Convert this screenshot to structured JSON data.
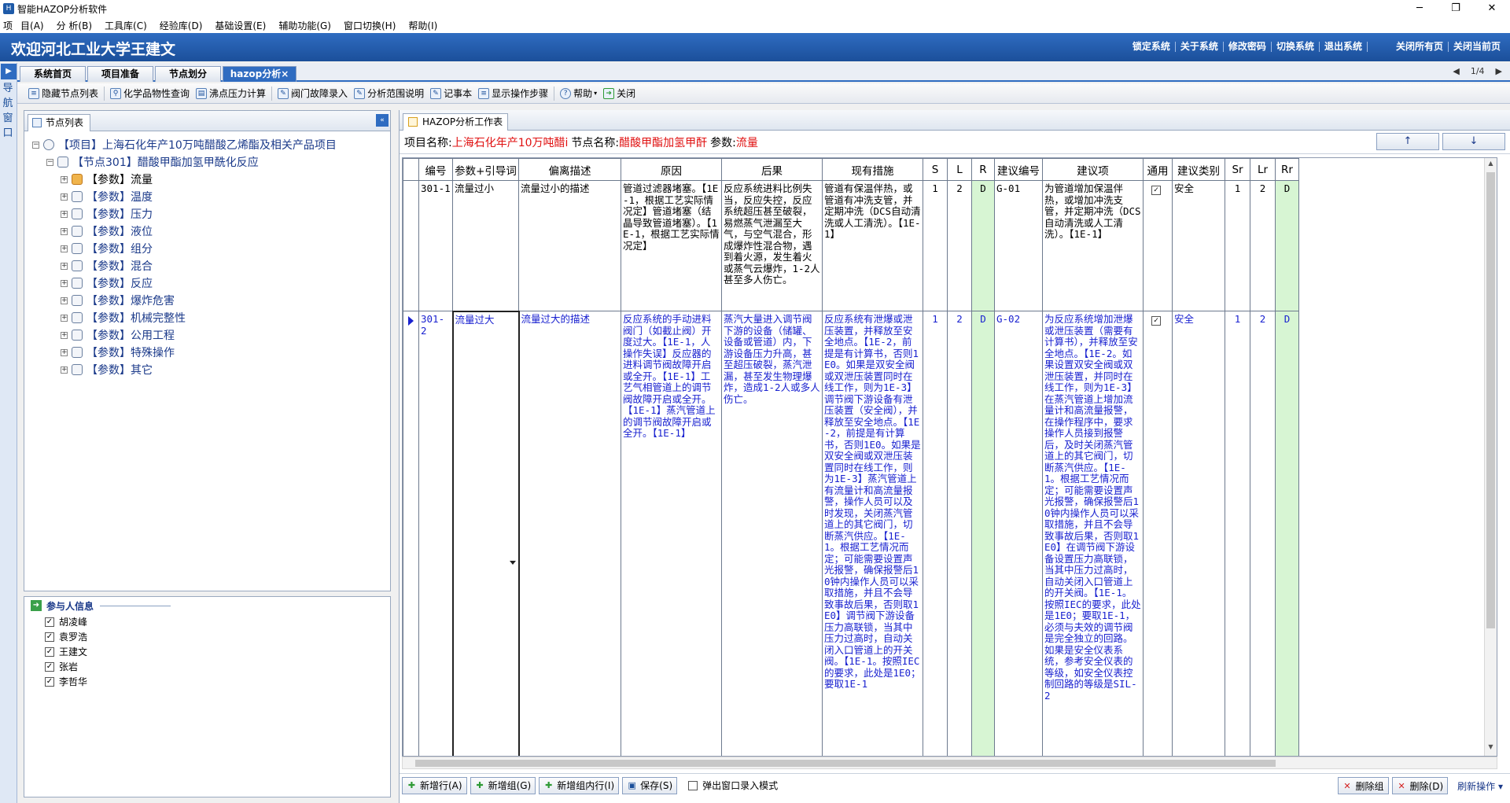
{
  "window": {
    "title": "智能HAZOP分析软件",
    "min": "─",
    "max": "❐",
    "close": "✕"
  },
  "menu": [
    "项",
    "目(A)",
    "分 析(B)",
    "工具库(C)",
    "经验库(D)",
    "基础设置(E)",
    "辅助功能(G)",
    "窗口切换(H)",
    "帮助(I)"
  ],
  "banner": {
    "welcome": "欢迎河北工业大学王建文",
    "links": [
      "锁定系统",
      "关于系统",
      "修改密码",
      "切换系统",
      "退出系统"
    ],
    "links2": [
      "关闭所有页",
      "关闭当前页"
    ]
  },
  "nav": {
    "arrow": "▶",
    "label": [
      "导",
      "航",
      "窗",
      "口"
    ]
  },
  "tabs": [
    "系统首页",
    "项目准备",
    "节点划分",
    "hazop分析×"
  ],
  "pager": {
    "prev": "◀",
    "page": "1/4",
    "next": "▶"
  },
  "toolbar": [
    "隐藏节点列表",
    "化学品物性查询",
    "沸点压力计算",
    "阀门故障录入",
    "分析范围说明",
    "记事本",
    "显示操作步骤",
    "帮助",
    "关闭"
  ],
  "left": {
    "tab": "节点列表",
    "collapse": "«",
    "project": "【项目】上海石化年产10万吨醋酸乙烯酯及相关产品项目",
    "node": "【节点301】醋酸甲酯加氢甲酰化反应",
    "params": [
      "【参数】流量",
      "【参数】温度",
      "【参数】压力",
      "【参数】液位",
      "【参数】组分",
      "【参数】混合",
      "【参数】反应",
      "【参数】爆炸危害",
      "【参数】机械完整性",
      "【参数】公用工程",
      "【参数】特殊操作",
      "【参数】其它"
    ]
  },
  "participants": {
    "title": "参与人信息",
    "people": [
      "胡凌峰",
      "袁罗浩",
      "王建文",
      "张岩",
      "李哲华"
    ]
  },
  "right": {
    "tab": "HAZOP分析工作表",
    "info": {
      "projLabel": "项目名称:",
      "projValue": "上海石化年产10万吨醋i",
      "nodeLabel": "节点名称:",
      "nodeValue": "醋酸甲酯加氢甲酐",
      "paramLabel": "参数:",
      "paramValue": "流量"
    },
    "up": "↑",
    "down": "↓"
  },
  "grid": {
    "headers": [
      "编号",
      "参数+引导词",
      "偏离描述",
      "原因",
      "后果",
      "现有措施",
      "S",
      "L",
      "R",
      "建议编号",
      "建议项",
      "通用",
      "建议类别",
      "Sr",
      "Lr",
      "Rr"
    ],
    "rows": [
      {
        "id": "301-1",
        "param": "流量过小",
        "dev": "流量过小的描述",
        "cause": "管道过滤器堵塞。【1E-1，根据工艺实际情况定】管道堵塞（结晶导致管道堵塞）。【1E-1，根据工艺实际情况定】",
        "conseq": "反应系统进料比例失当，反应失控，反应系统超压甚至破裂，易燃蒸气泄漏至大气，与空气混合，形成爆炸性混合物，遇到着火源，发生着火或蒸气云爆炸，1-2人甚至多人伤亡。",
        "measure": "管道有保温伴热，或管道有冲洗支管，并定期冲洗（DCS自动清洗或人工清洗）。【1E-1】",
        "s": "1",
        "l": "2",
        "r": "D",
        "sid": "G-01",
        "sugg": "为管道增加保温伴热，或增加冲洗支管，并定期冲洗（DCS自动清洗或人工清洗）。【1E-1】",
        "common": "✓",
        "cat": "安全",
        "sr": "1",
        "lr": "2",
        "rr": "D"
      },
      {
        "id": "301-2",
        "param": "流量过大",
        "dev": "流量过大的描述",
        "cause": "反应系统的手动进料阀门（如截止阀）开度过大。【1E-1，人操作失误】反应器的进料调节阀故障开启或全开。【1E-1】工艺气相管道上的调节阀故障开启或全开。【1E-1】蒸汽管道上的调节阀故障开启或全开。【1E-1】",
        "conseq": "蒸汽大量进入调节阀下游的设备（储罐、设备或管道）内，下游设备压力升高，甚至超压破裂，蒸汽泄漏，甚至发生物理爆炸，造成1-2人或多人伤亡。",
        "measure": "反应系统有泄爆或泄压装置，并释放至安全地点。【1E-2，前提是有计算书，否则1E0。如果是双安全阀或双泄压装置同时在线工作，则为1E-3】调节阀下游设备有泄压装置（安全阀），并释放至安全地点。【1E-2，前提是有计算书，否则1E0。如果是双安全阀或双泄压装置同时在线工作，则为1E-3】蒸汽管道上有流量计和高流量报警，操作人员可以及时发现，关闭蒸汽管道上的其它阀门，切断蒸汽供应。【1E-1。根据工艺情况而定；可能需要设置声光报警，确保报警后10钟内操作人员可以采取措施，并且不会导致事故后果，否则取1E0】调节阀下游设备压力高联锁，当其中压力过高时，自动关闭入口管道上的开关阀。【1E-1。按照IEC的要求，此处是1E0；要取1E-1",
        "s": "1",
        "l": "2",
        "r": "D",
        "sid": "G-02",
        "sugg": "为反应系统增加泄爆或泄压装置（需要有计算书），并释放至安全地点。【1E-2。如果设置双安全阀或双泄压装置，并同时在线工作，则为1E-3】在蒸汽管道上增加流量计和高流量报警，在操作程序中，要求操作人员接到报警后，及时关闭蒸汽管道上的其它阀门，切断蒸汽供应。【1E-1。根据工艺情况而定；可能需要设置声光报警，确保报警后10钟内操作人员可以采取措施，并且不会导致事故后果，否则取1E0】在调节阀下游设备设置压力高联锁，当其中压力过高时，自动关闭入口管道上的开关阀。【1E-1。按照IEC的要求，此处是1E0；要取1E-1，必须与夫效的调节阀是完全独立的回路。如果是安全仪表系统，参考安全仪表的等级，如安全仪表控制回路的等级是SIL-2",
        "common": "✓",
        "cat": "安全",
        "sr": "1",
        "lr": "2",
        "rr": "D"
      }
    ]
  },
  "bottom": {
    "buttons": [
      "新增行(A)",
      "新增组(G)",
      "新增组内行(I)",
      "保存(S)"
    ],
    "popup": "弹出窗口录入模式",
    "del1": "删除组",
    "del2": "删除(D)",
    "refresh": "刷新操作 ▾"
  }
}
